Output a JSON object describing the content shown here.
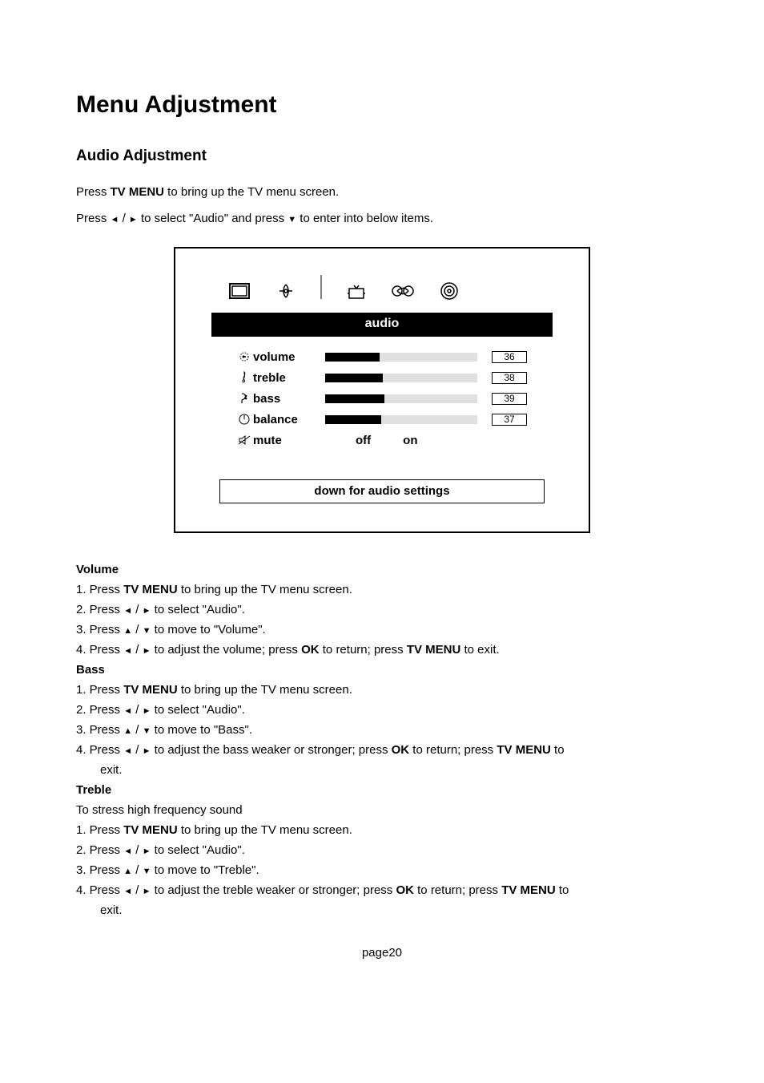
{
  "title": "Menu Adjustment",
  "section_title": "Audio Adjustment",
  "intro1_pre": "Press  ",
  "intro1_bold": "TV MENU",
  "intro1_post": "  to bring up the TV menu screen.",
  "intro2_pre": "Press ",
  "intro2_mid": " to select \"Audio\" and press ",
  "intro2_post": "  to enter into below items.",
  "osd": {
    "title": "audio",
    "rows": {
      "volume": {
        "label": "volume",
        "value": "36",
        "fill": 36
      },
      "treble": {
        "label": "treble",
        "value": "38",
        "fill": 38
      },
      "bass": {
        "label": "bass",
        "value": "39",
        "fill": 39
      },
      "balance": {
        "label": "balance",
        "value": "37",
        "fill": 37
      },
      "mute": {
        "label": "mute",
        "off": "off",
        "on": "on"
      }
    },
    "hint": "down for audio settings"
  },
  "volume": {
    "heading": "Volume",
    "s1_pre": "1. Press  ",
    "s1_bold": "TV MENU",
    "s1_post": "  to bring up the TV menu screen.",
    "s2_pre": "2. Press ",
    "s2_post": " to select \"Audio\".",
    "s3_pre": "3. Press ",
    "s3_post": "  to move to \"Volume\".",
    "s4_pre": "4. Press ",
    "s4_mid1": " to adjust the volume; press  ",
    "s4_bold1": "OK",
    "s4_mid2": "  to return; press  ",
    "s4_bold2": "TV MENU",
    "s4_post": "  to exit."
  },
  "bass": {
    "heading": "Bass",
    "s1_pre": "1. Press  ",
    "s1_bold": "TV MENU",
    "s1_post": "  to bring up the TV menu screen.",
    "s2_pre": "2. Press ",
    "s2_post": " to select \"Audio\".",
    "s3_pre": "3. Press  ",
    "s3_post": "  to move to \"Bass\".",
    "s4_pre": "4. Press ",
    "s4_mid1": " to adjust the bass weaker or stronger; press  ",
    "s4_bold1": "OK",
    "s4_mid2": "  to return; press  ",
    "s4_bold2": "TV MENU",
    "s4_post": "  to",
    "s4_line2": "exit."
  },
  "treble": {
    "heading": "Treble",
    "note": "To stress high frequency sound",
    "s1_pre": "1. Press  ",
    "s1_bold": "TV MENU",
    "s1_post": "  to bring up the TV menu screen.",
    "s2_pre": "2. Press ",
    "s2_post": " to select \"Audio\".",
    "s3_pre": "3. Press  ",
    "s3_post": "  to move to \"Treble\".",
    "s4_pre": "4. Press ",
    "s4_mid1": " to adjust the treble weaker or stronger; press  ",
    "s4_bold1": "OK",
    "s4_mid2": "  to return; press  ",
    "s4_bold2": "TV MENU",
    "s4_post": "  to",
    "s4_line2": "exit."
  },
  "footer": "page20"
}
